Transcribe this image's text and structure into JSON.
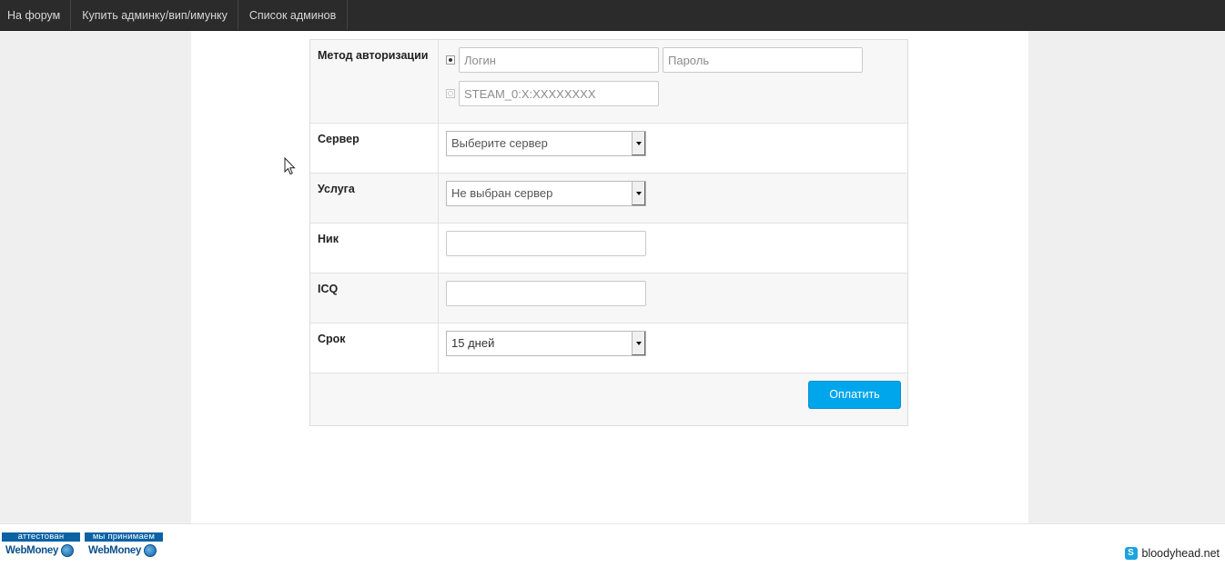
{
  "nav": {
    "items": [
      {
        "label": "На форум"
      },
      {
        "label": "Купить админку/вип/имунку"
      },
      {
        "label": "Список админов"
      }
    ]
  },
  "form": {
    "auth": {
      "label": "Метод авторизации",
      "login_placeholder": "Логин",
      "password_placeholder": "Пароль",
      "steam_placeholder": "STEAM_0:X:XXXXXXXX",
      "selected_method": "login"
    },
    "server": {
      "label": "Сервер",
      "value": "Выберите сервер"
    },
    "service": {
      "label": "Услуга",
      "value": "Не выбран сервер"
    },
    "nick": {
      "label": "Ник",
      "value": ""
    },
    "icq": {
      "label": "ICQ",
      "value": ""
    },
    "term": {
      "label": "Срок",
      "value": "15 дней"
    },
    "submit_label": "Оплатить"
  },
  "footer": {
    "badges": [
      {
        "top": "аттестован",
        "name": "WebMoney"
      },
      {
        "top": "мы принимаем",
        "name": "WebMoney"
      }
    ],
    "skype": {
      "icon": "skype-icon",
      "label": "bloodyhead.net"
    }
  },
  "colors": {
    "accent": "#00a6ec",
    "nav_bg": "#2b2b2b",
    "page_bg": "#efefef"
  }
}
